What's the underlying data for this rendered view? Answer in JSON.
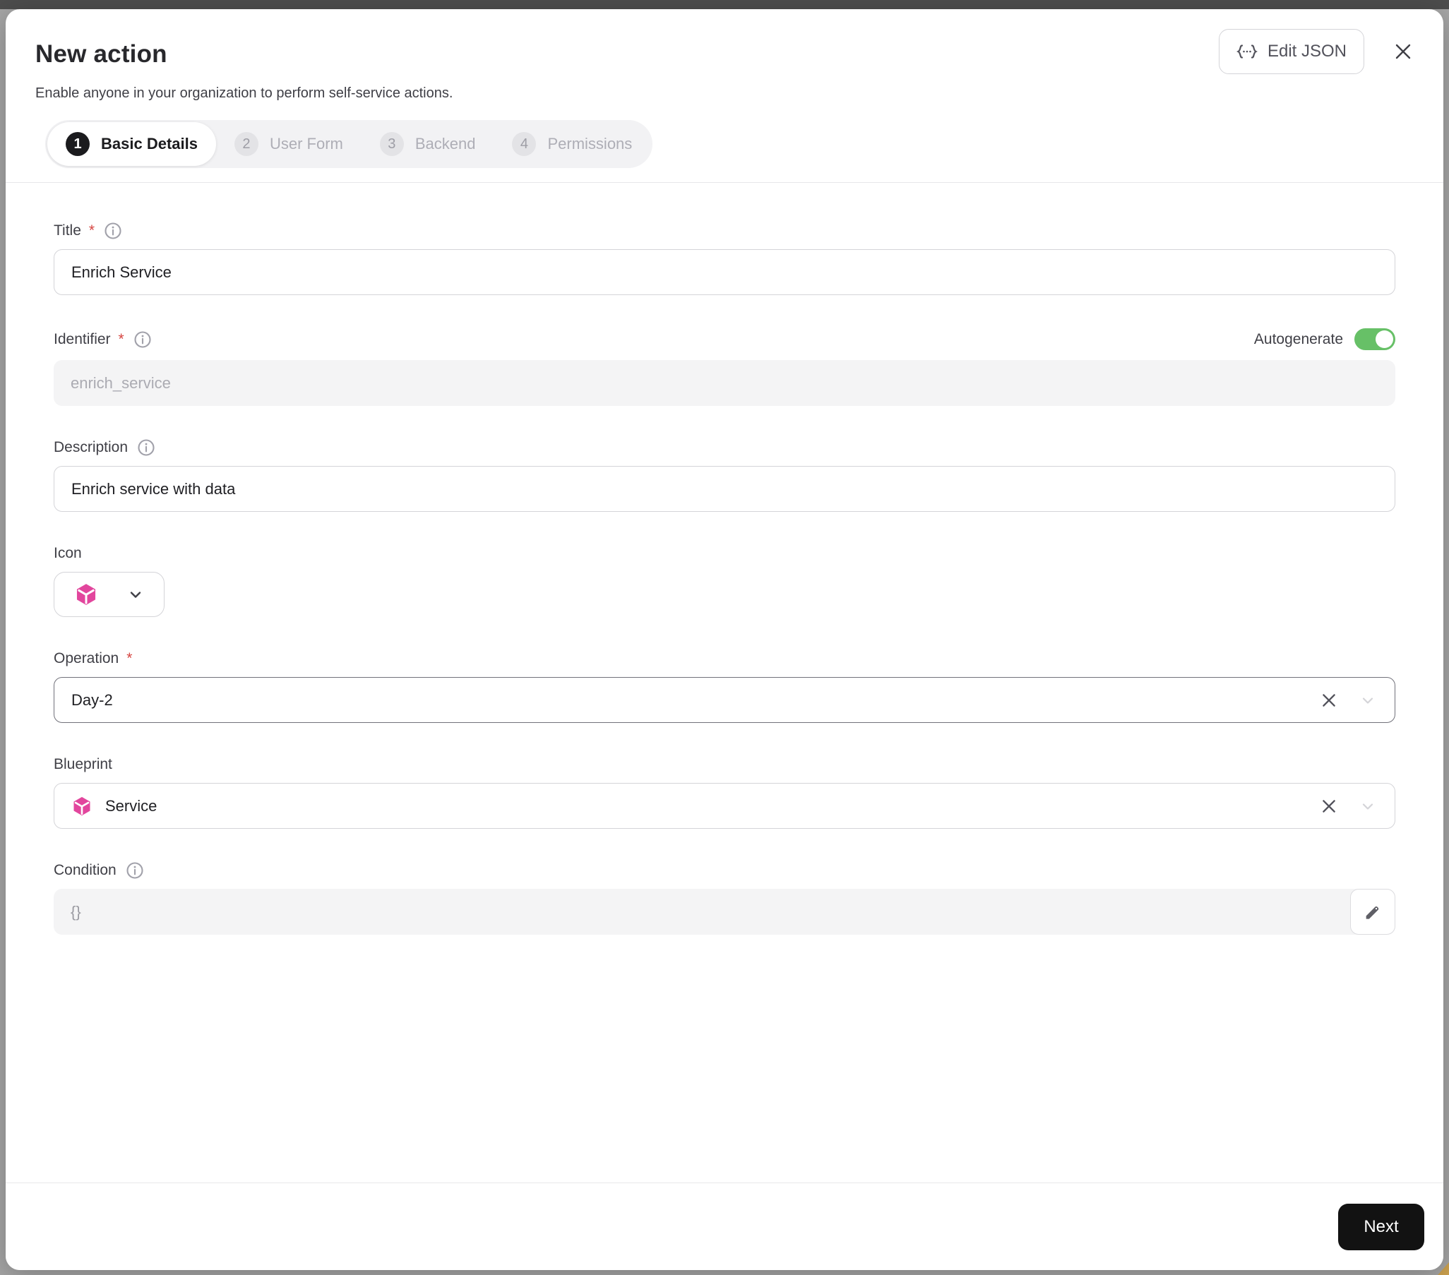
{
  "modal": {
    "title": "New action",
    "subtitle": "Enable anyone in your organization to perform self-service actions.",
    "edit_json_label": "Edit JSON"
  },
  "stepper": {
    "steps": [
      {
        "num": "1",
        "label": "Basic Details",
        "active": true
      },
      {
        "num": "2",
        "label": "User Form",
        "active": false
      },
      {
        "num": "3",
        "label": "Backend",
        "active": false
      },
      {
        "num": "4",
        "label": "Permissions",
        "active": false
      }
    ]
  },
  "form": {
    "required_mark": "*",
    "title": {
      "label": "Title",
      "value": "Enrich Service"
    },
    "identifier": {
      "label": "Identifier",
      "value": "enrich_service",
      "autogenerate_label": "Autogenerate",
      "autogenerate_state": "on"
    },
    "description": {
      "label": "Description",
      "value": "Enrich service with data"
    },
    "icon_field": {
      "label": "Icon",
      "selected_icon": "cube-icon"
    },
    "operation": {
      "label": "Operation",
      "value": "Day-2"
    },
    "blueprint": {
      "label": "Blueprint",
      "value": "Service",
      "icon": "cube-icon"
    },
    "condition": {
      "label": "Condition",
      "placeholder": "{}"
    }
  },
  "footer": {
    "next_label": "Next"
  },
  "colors": {
    "accent_pink": "#E2469D",
    "toggle_green": "#67C067",
    "step_active_bg": "#1B1B1E",
    "required_red": "#D64541"
  }
}
